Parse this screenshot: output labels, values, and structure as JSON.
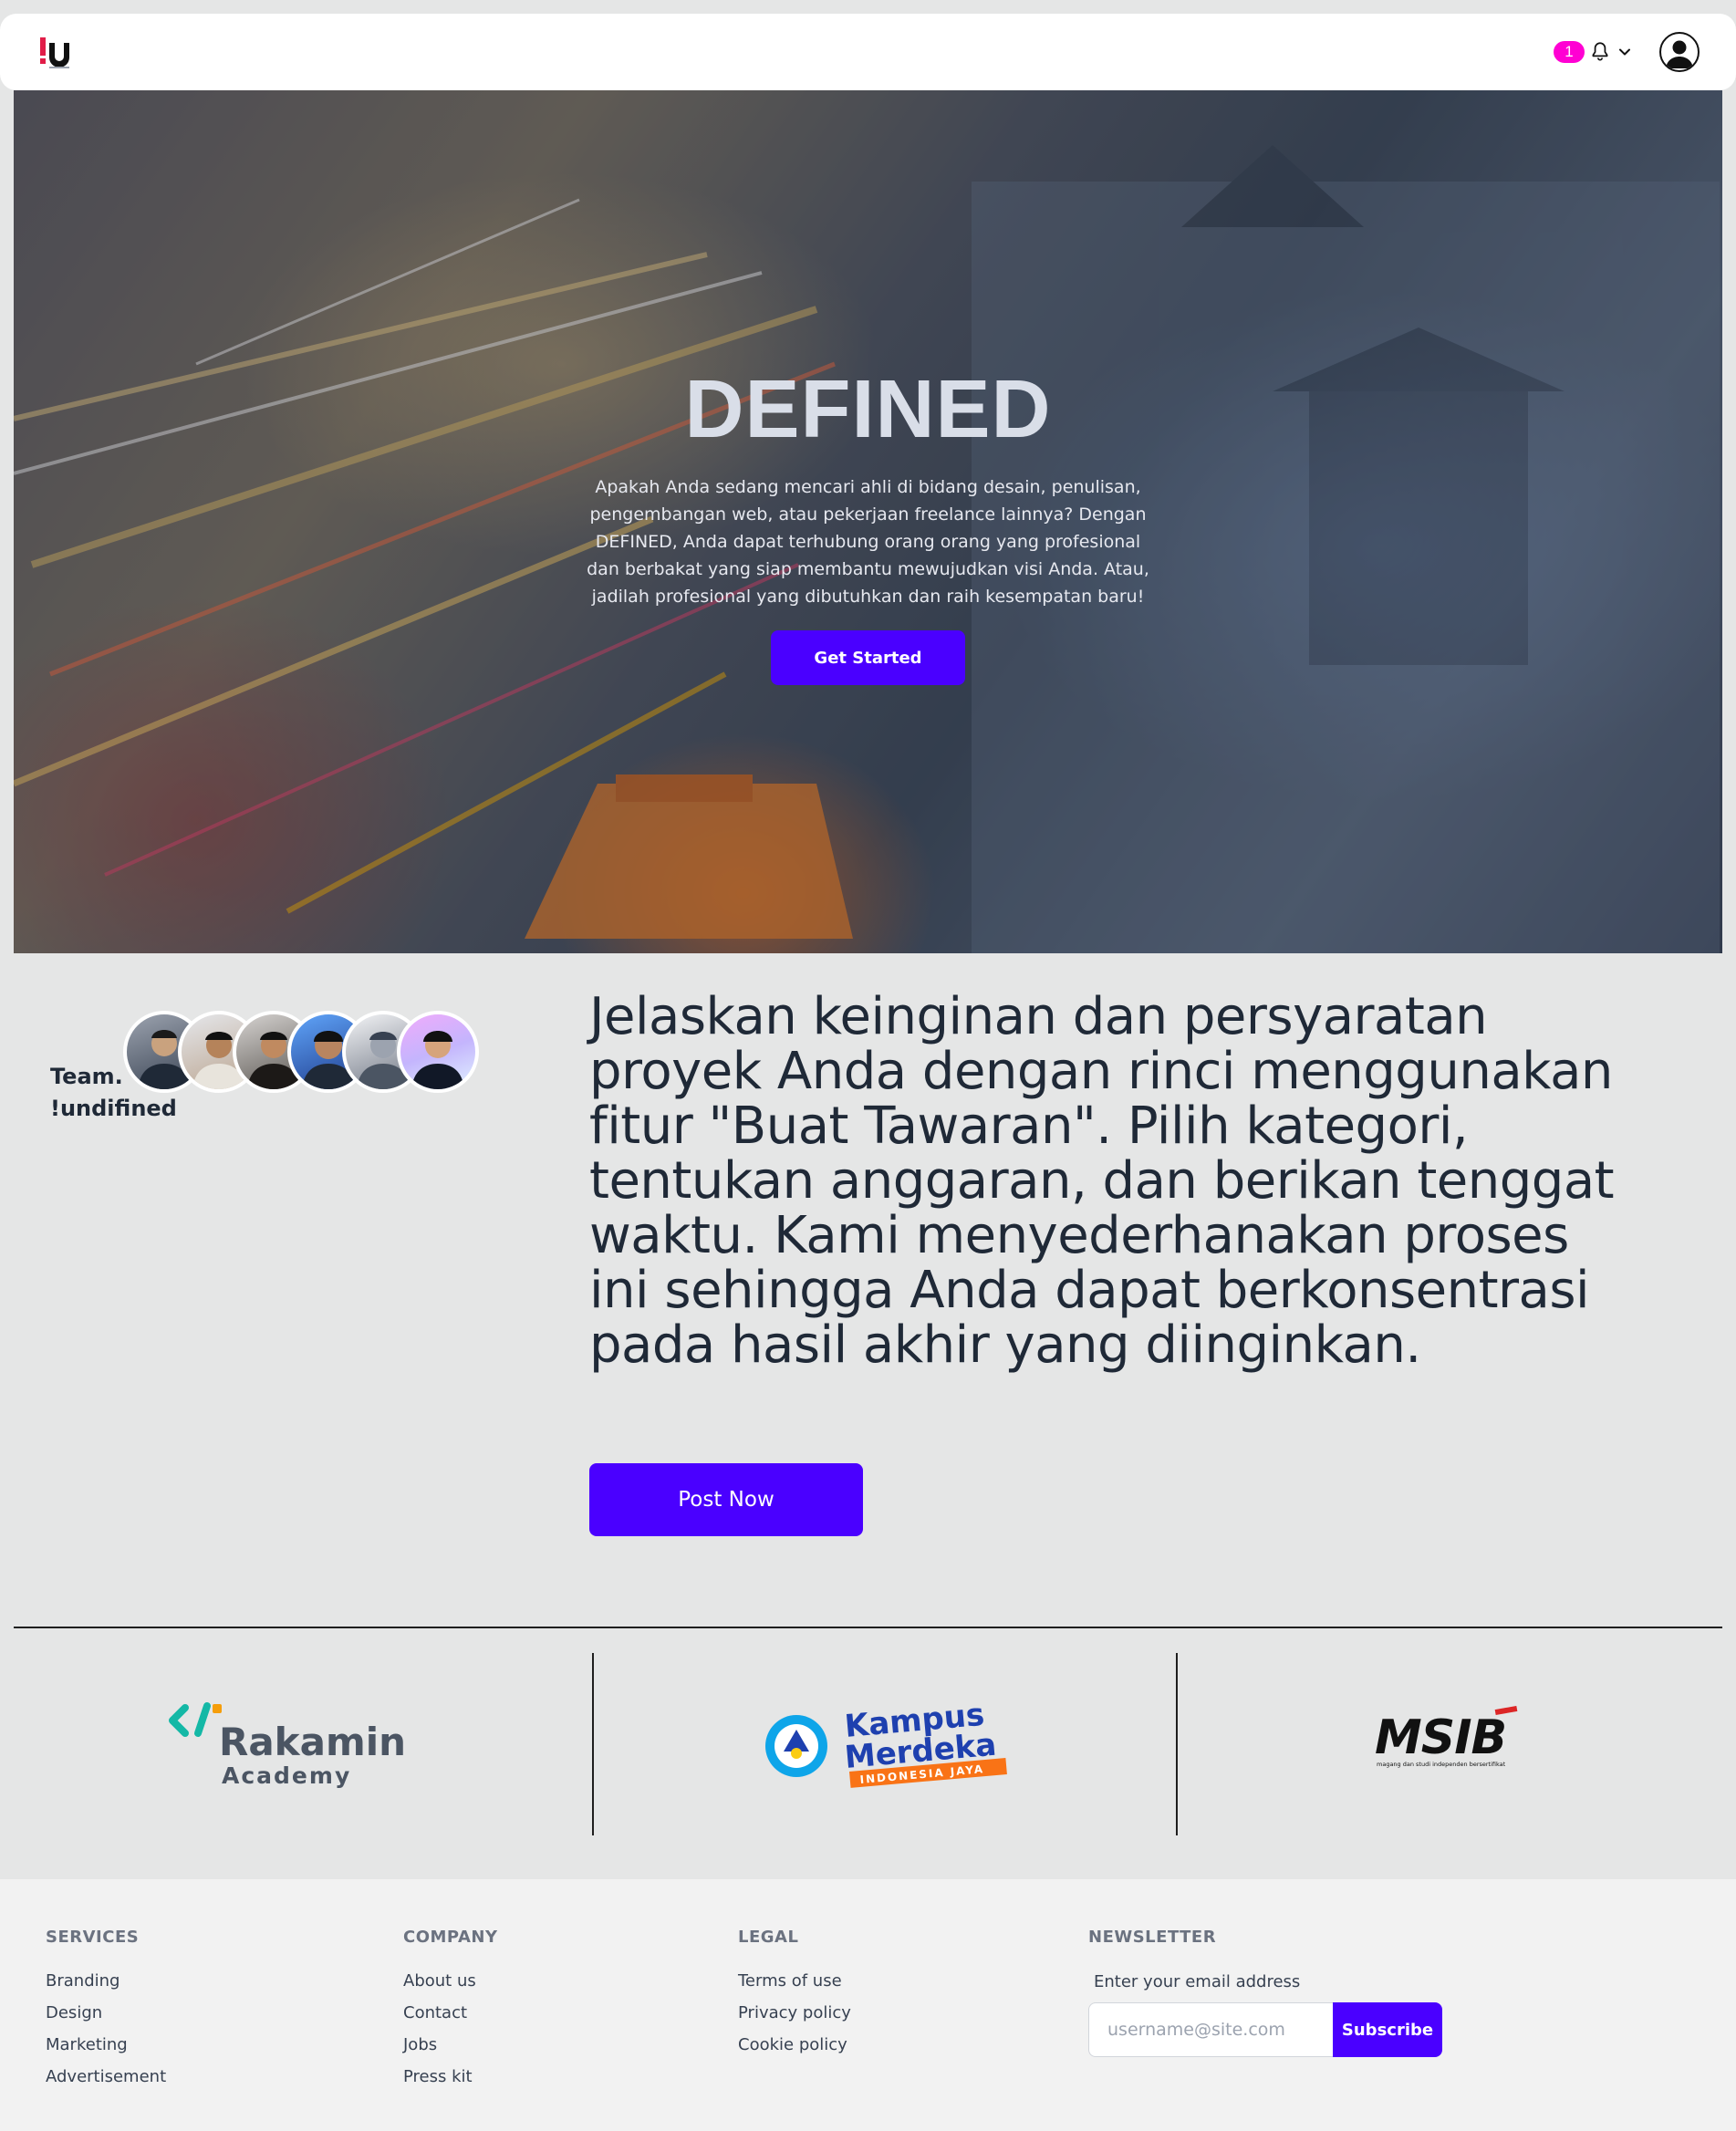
{
  "navbar": {
    "logo_text": "!u",
    "notification_count": "1",
    "icons": [
      "bell-icon",
      "chevron-down-icon",
      "user-icon"
    ]
  },
  "hero": {
    "title": "DEFINED",
    "description": "Apakah Anda sedang mencari ahli di bidang desain, penulisan, pengembangan web, atau pekerjaan freelance lainnya? Dengan DEFINED, Anda dapat terhubung orang orang yang profesional dan berbakat yang siap membantu mewujudkan visi Anda. Atau, jadilah profesional yang dibutuhkan dan raih kesempatan baru!",
    "cta_label": "Get Started"
  },
  "team": {
    "label": "Team. !undifined",
    "member_count": 6
  },
  "intro": {
    "text": "Jelaskan keinginan dan persyaratan proyek Anda dengan rinci menggunakan fitur \"Buat Tawaran\". Pilih kategori, tentukan anggaran, dan berikan tenggat waktu. Kami menyederhanakan proses ini sehingga Anda dapat berkonsentrasi pada hasil akhir yang diinginkan.",
    "cta_label": "Post Now"
  },
  "partners": {
    "rakamin": {
      "line1": "Rakamin",
      "line2": "Academy"
    },
    "kampus_merdeka": {
      "line1": "Kampus",
      "line2": "Merdeka",
      "tagline": "INDONESIA JAYA"
    },
    "msib": {
      "name": "MSIB",
      "tagline": "magang dan studi independen bersertifikat"
    }
  },
  "footer": {
    "services": {
      "heading": "SERVICES",
      "links": [
        "Branding",
        "Design",
        "Marketing",
        "Advertisement"
      ]
    },
    "company": {
      "heading": "COMPANY",
      "links": [
        "About us",
        "Contact",
        "Jobs",
        "Press kit"
      ]
    },
    "legal": {
      "heading": "LEGAL",
      "links": [
        "Terms of use",
        "Privacy policy",
        "Cookie policy"
      ]
    },
    "newsletter": {
      "heading": "NEWSLETTER",
      "label": "Enter your email address",
      "placeholder": "username@site.com",
      "button_label": "Subscribe"
    }
  },
  "colors": {
    "accent": "#4a00ff",
    "badge": "#ff00d3",
    "page_bg": "#e5e6e6",
    "footer_bg": "#f2f2f2"
  }
}
